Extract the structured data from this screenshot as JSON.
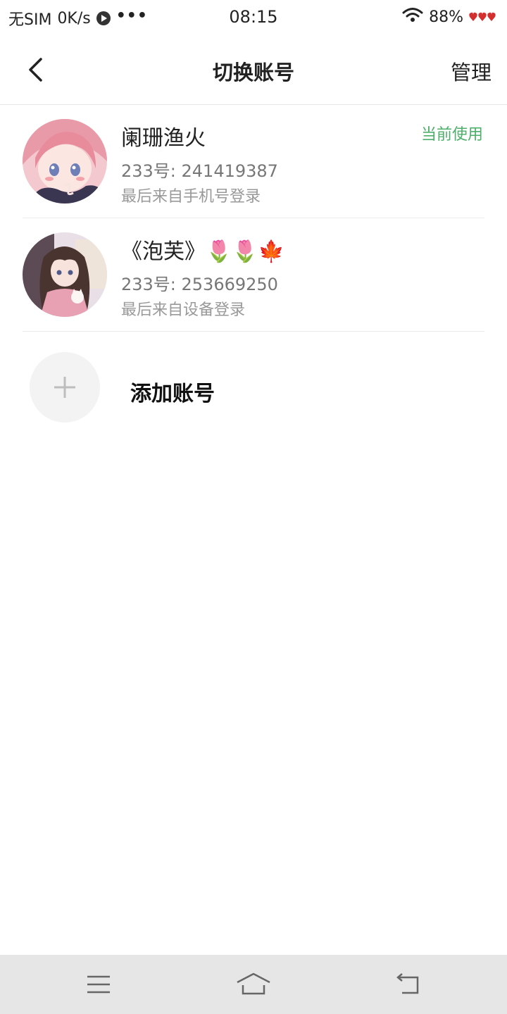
{
  "status_bar": {
    "sim": "无SIM",
    "speed": "0K/s",
    "more": "•••",
    "time": "08:15",
    "battery": "88%"
  },
  "nav": {
    "title": "切换账号",
    "manage_label": "管理",
    "back_icon": "chevron-left-icon"
  },
  "accounts": [
    {
      "name": "阑珊渔火",
      "id_text": "233号: 241419387",
      "login_text": "最后来自手机号登录",
      "current_label": "当前使用"
    },
    {
      "name": "《泡芙》🌷🌷🍁",
      "id_text": "233号: 253669250",
      "login_text": "最后来自设备登录"
    }
  ],
  "add_account": {
    "label": "添加账号",
    "icon": "plus-icon"
  },
  "colors": {
    "accent_green": "#4caf6a",
    "text_primary": "#222222",
    "text_secondary": "#777777",
    "bottom_bar": "#e6e6e6"
  }
}
